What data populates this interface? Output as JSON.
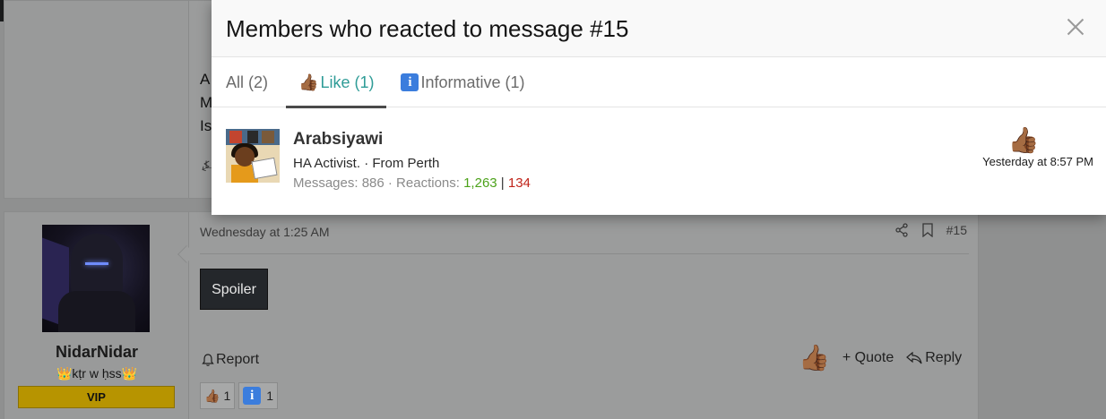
{
  "modal": {
    "title": "Members who reacted to message #15",
    "tabs": [
      {
        "label": "All (2)",
        "emoji": ""
      },
      {
        "label": "Like (1)",
        "emoji": "👍🏾"
      },
      {
        "label": "Informative (1)",
        "emoji": "i"
      }
    ],
    "active_tab": 1,
    "members": [
      {
        "name": "Arabsiyawi",
        "title": "HA Activist. · From Perth",
        "stats_label": "Messages: 886 · Reactions: ",
        "reactions_positive": "1,263",
        "separator": " | ",
        "reactions_negative": "134",
        "reaction_emoji": "👍🏾",
        "reaction_time": "Yesterday at 8:57 PM"
      }
    ]
  },
  "background": {
    "prev_post_lines": [
      "A",
      "M",
      "Is"
    ],
    "post": {
      "username": "NidarNidar",
      "user_title": "👑kṭr w ḥss👑",
      "banner": "VIP",
      "date": "Wednesday at 1:25 AM",
      "post_number": "#15",
      "spoiler_label": "Spoiler",
      "report_label": "Report",
      "quote_label": "+ Quote",
      "reply_label": "Reply",
      "like_emoji": "👍🏾",
      "reactions": [
        {
          "emoji": "👍🏾",
          "count": "1"
        },
        {
          "emoji": "i",
          "count": "1"
        }
      ]
    }
  },
  "colors": {
    "accent_tab": "#2f9c97",
    "positive": "#4ca21a",
    "negative": "#c0241a",
    "vip": "#b79400"
  }
}
